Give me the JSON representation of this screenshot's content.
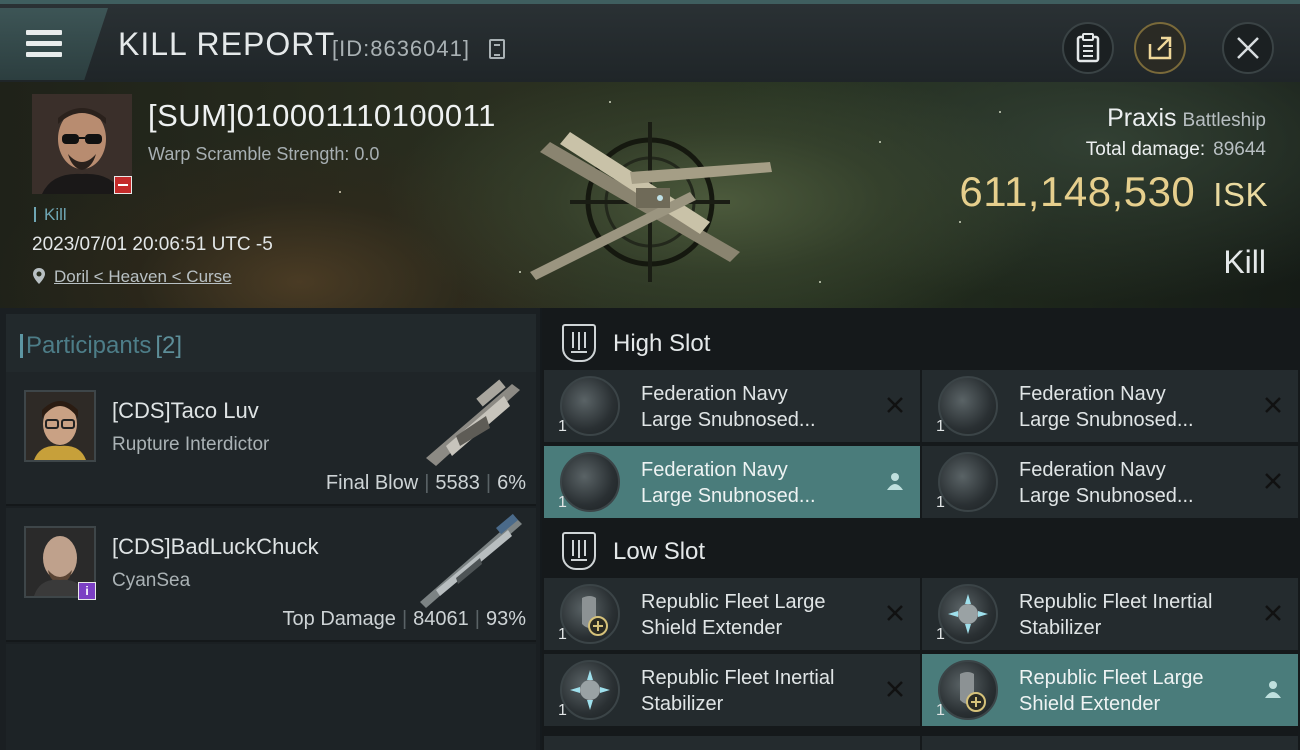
{
  "header": {
    "menu_icon": "hamburger-menu-icon",
    "title": "KILL REPORT",
    "report_id": "[ID:8636041]",
    "copy_icon": "copy-icon",
    "clipboard_icon": "clipboard-icon",
    "share_icon": "share-icon",
    "close_icon": "close-icon"
  },
  "victim": {
    "name": "[SUM]010001110100011",
    "warp_scramble": "Warp Scramble Strength: 0.0",
    "kill_label": "Kill",
    "datetime": "2023/07/01 20:06:51 UTC -5",
    "location": "Doril < Heaven < Curse",
    "ship_name": "Praxis",
    "ship_class": "Battleship",
    "total_damage_label": "Total damage:",
    "total_damage": "89644",
    "isk_value": "611,148,530",
    "isk_unit": "ISK",
    "result": "Kill"
  },
  "participants": {
    "title": "Participants",
    "count": "[2]",
    "items": [
      {
        "name": "[CDS]Taco Luv",
        "ship": "Rupture Interdictor",
        "role": "Final Blow",
        "damage": "5583",
        "percent": "6%"
      },
      {
        "name": "[CDS]BadLuckChuck",
        "ship": "CyanSea",
        "role": "Top Damage",
        "damage": "84061",
        "percent": "93%"
      }
    ]
  },
  "slots": {
    "high": {
      "title": "High Slot",
      "items": [
        {
          "qty": "1",
          "name1": "Federation Navy",
          "name2": "Large Snubnosed...",
          "status": "destroyed"
        },
        {
          "qty": "1",
          "name1": "Federation Navy",
          "name2": "Large Snubnosed...",
          "status": "destroyed"
        },
        {
          "qty": "1",
          "name1": "Federation Navy",
          "name2": "Large Snubnosed...",
          "status": "dropped"
        },
        {
          "qty": "1",
          "name1": "Federation Navy",
          "name2": "Large Snubnosed...",
          "status": "destroyed"
        }
      ]
    },
    "low": {
      "title": "Low Slot",
      "items": [
        {
          "qty": "1",
          "name1": "Republic Fleet Large",
          "name2": "Shield Extender",
          "status": "destroyed"
        },
        {
          "qty": "1",
          "name1": "Republic Fleet Inertial",
          "name2": "Stabilizer",
          "status": "destroyed"
        },
        {
          "qty": "1",
          "name1": "Republic Fleet Inertial",
          "name2": "Stabilizer",
          "status": "destroyed"
        },
        {
          "qty": "1",
          "name1": "Republic Fleet Large",
          "name2": "Shield Extender",
          "status": "dropped"
        }
      ]
    }
  },
  "colors": {
    "accent_teal": "#4a7c7b",
    "isk_gold": "#e6cf8d",
    "badge_red": "#c42b2b",
    "badge_purple": "#7b3fc4"
  }
}
